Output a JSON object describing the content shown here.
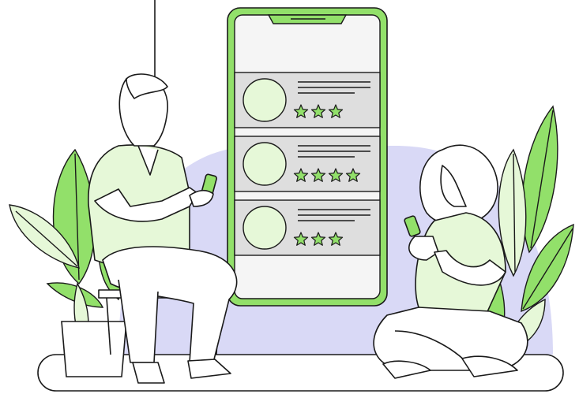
{
  "palette": {
    "outline": "#1a1a1a",
    "green_accent": "#92e06a",
    "green_light": "#e6f8d8",
    "screen_fill": "#f5f5f5",
    "card_fill": "#dedede",
    "blob_lavender": "#d9d9f6",
    "ground": "#ffffff"
  },
  "phone": {
    "review_cards": [
      {
        "rating": 3,
        "max_visible_stars": 3
      },
      {
        "rating": 4,
        "max_visible_stars": 4
      },
      {
        "rating": 3,
        "max_visible_stars": 3
      }
    ]
  },
  "icons": [
    "avatar-circle",
    "star-icon",
    "leaf-plant",
    "hanging-cord"
  ]
}
